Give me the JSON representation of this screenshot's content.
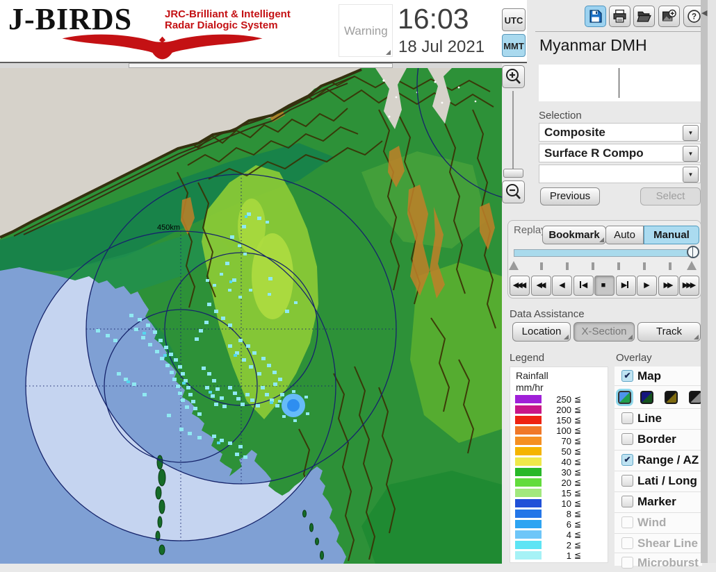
{
  "icons": {
    "dropdown": "▼",
    "check": "✔",
    "panel_collapse": "◀",
    "help_glyph": "?"
  },
  "header": {
    "logo": {
      "title": "J-BIRDS",
      "tagline1": "JRC-Brilliant & Intelligent",
      "tagline2": "Radar  Dialogic  System",
      "accent_color": "#C41114"
    },
    "warning_label": "Warning",
    "clock": {
      "time": "16:03",
      "date": "18 Jul 2021"
    },
    "timezone": {
      "utc": "UTC",
      "mmt": "MMT",
      "selected": "MMT"
    },
    "toolbar": {
      "save": "save",
      "print": "print",
      "open": "open-folder",
      "capture": "capture-image",
      "help": "help"
    }
  },
  "panel": {
    "station_name": "Myanmar DMH",
    "selection": {
      "label": "Selection",
      "dropdowns": [
        {
          "value": "Composite"
        },
        {
          "value": "Surface R Compo"
        },
        {
          "value": ""
        }
      ],
      "previous_label": "Previous",
      "select_label": "Select"
    },
    "replay": {
      "label": "Replay",
      "bookmark_label": "Bookmark",
      "auto_label": "Auto",
      "manual_label": "Manual",
      "active_mode": "Manual",
      "playback": [
        {
          "name": "rewind-fastest",
          "glyph": "◀◀◀"
        },
        {
          "name": "rewind-fast",
          "glyph": "◀◀"
        },
        {
          "name": "play-backward",
          "glyph": "◀"
        },
        {
          "name": "step-backward",
          "glyph": "◀"
        },
        {
          "name": "stop",
          "glyph": "■"
        },
        {
          "name": "step-forward",
          "glyph": "▶"
        },
        {
          "name": "play-forward",
          "glyph": "▶"
        },
        {
          "name": "forward-fast",
          "glyph": "▶▶"
        },
        {
          "name": "forward-fastest",
          "glyph": "▶▶▶"
        }
      ]
    },
    "data_assistance": {
      "label": "Data Assistance",
      "buttons": [
        {
          "label": "Location",
          "state": "normal"
        },
        {
          "label": "X-Section",
          "state": "pressed"
        },
        {
          "label": "Track",
          "state": "normal"
        }
      ]
    },
    "legend": {
      "label": "Legend",
      "unit_line1": "Rainfall",
      "unit_line2": "mm/hr",
      "lte": "≦",
      "rows": [
        {
          "value": "250",
          "color": "#A020D8"
        },
        {
          "value": "200",
          "color": "#C81688"
        },
        {
          "value": "150",
          "color": "#EE2211"
        },
        {
          "value": "100",
          "color": "#F07828"
        },
        {
          "value": "70",
          "color": "#F59022"
        },
        {
          "value": "50",
          "color": "#F5B400"
        },
        {
          "value": "40",
          "color": "#EFE84A"
        },
        {
          "value": "30",
          "color": "#28B828"
        },
        {
          "value": "20",
          "color": "#62DC3C"
        },
        {
          "value": "15",
          "color": "#A2E87E"
        },
        {
          "value": "10",
          "color": "#2050D8"
        },
        {
          "value": "8",
          "color": "#2476E8"
        },
        {
          "value": "6",
          "color": "#2EA4F2"
        },
        {
          "value": "4",
          "color": "#6EC6F8"
        },
        {
          "value": "2",
          "color": "#5EE4F4"
        },
        {
          "value": "1",
          "color": "#A6F2F6"
        }
      ]
    },
    "overlay": {
      "label": "Overlay",
      "items": [
        {
          "label": "Map",
          "checked": true,
          "disabled": false
        },
        {
          "label": "Line",
          "checked": false,
          "disabled": false
        },
        {
          "label": "Border",
          "checked": false,
          "disabled": false
        },
        {
          "label": "Range / AZ",
          "checked": true,
          "disabled": false
        },
        {
          "label": "Lati / Long",
          "checked": false,
          "disabled": false
        },
        {
          "label": "Marker",
          "checked": false,
          "disabled": false
        },
        {
          "label": "Wind",
          "checked": false,
          "disabled": true
        },
        {
          "label": "Shear Line",
          "checked": false,
          "disabled": true
        },
        {
          "label": "Microburst",
          "checked": false,
          "disabled": true
        }
      ],
      "map_styles": [
        {
          "selected": true,
          "gradient": "linear-gradient(135deg,#4E94EC 48%,#1FA04C 52%)"
        },
        {
          "selected": false,
          "gradient": "linear-gradient(135deg,#14147E 48%,#14521E 52%)"
        },
        {
          "selected": false,
          "gradient": "linear-gradient(135deg,#141414 48%,#7E6A10 52%)"
        },
        {
          "selected": false,
          "gradient": "linear-gradient(135deg,#141414 48%,#8C8C8C 52%)"
        }
      ]
    }
  },
  "map": {
    "range_label": "450km",
    "colors": {
      "sea": "#7FA0D4",
      "sea_in_range": "#C5D4F0",
      "land": "#2D9138",
      "no_data_gray": "#D6D2CA",
      "rain_light": "#8FE9F2",
      "rain_heavy": "#2E8EF0",
      "ring": "#16246B"
    }
  }
}
